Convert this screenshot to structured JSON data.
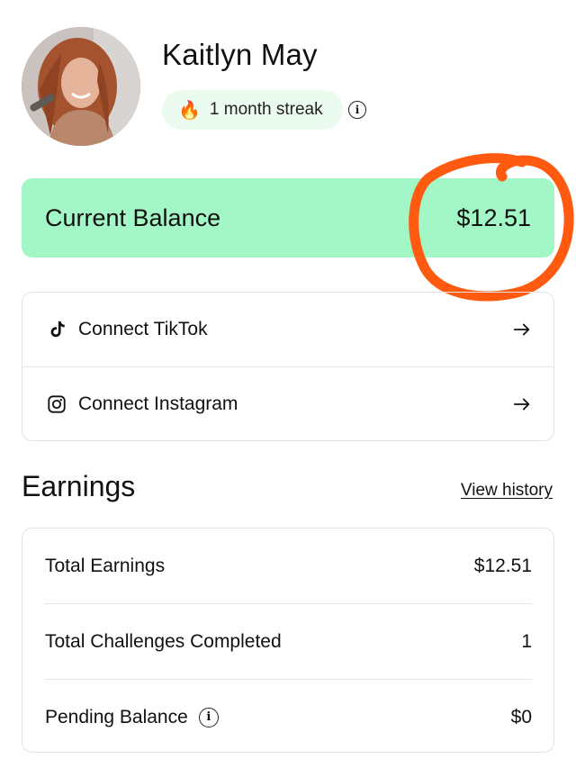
{
  "profile": {
    "name": "Kaitlyn May",
    "streak_label": "1 month streak",
    "streak_icon": "fire-icon"
  },
  "balance": {
    "label": "Current Balance",
    "value": "$12.51",
    "color": "#a3f7c6",
    "annotation_color": "#ff5a0f"
  },
  "connect": {
    "items": [
      {
        "label": "Connect TikTok",
        "icon": "tiktok-icon"
      },
      {
        "label": "Connect Instagram",
        "icon": "instagram-icon"
      }
    ]
  },
  "earnings": {
    "title": "Earnings",
    "view_history": "View history",
    "rows": [
      {
        "label": "Total Earnings",
        "value": "$12.51"
      },
      {
        "label": "Total Challenges Completed",
        "value": "1"
      },
      {
        "label": "Pending Balance",
        "value": "$0"
      }
    ]
  }
}
